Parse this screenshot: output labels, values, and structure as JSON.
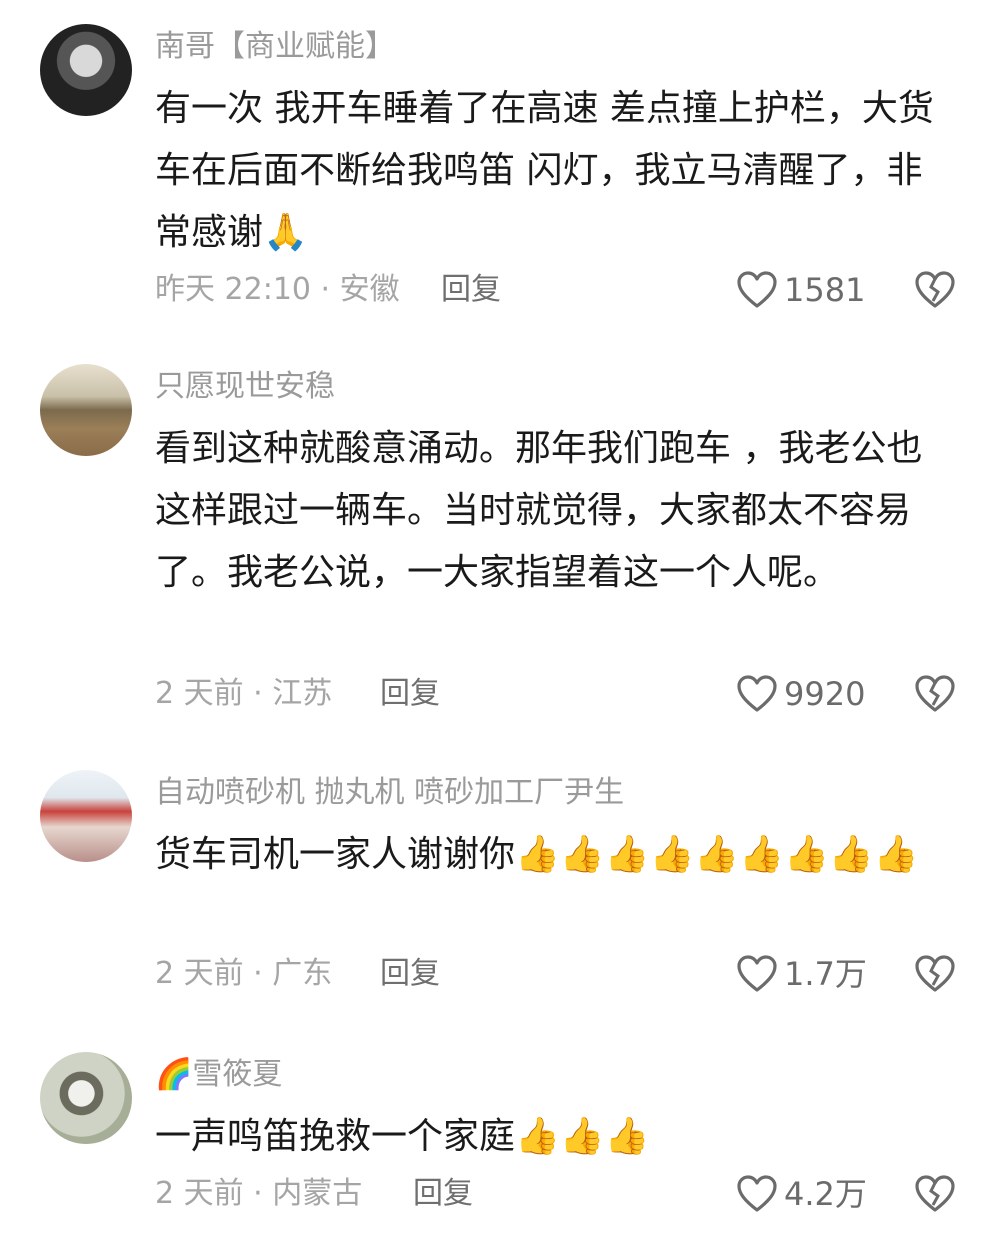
{
  "comments": [
    {
      "username": "南哥【商业赋能】",
      "avatar_icon": "avatar-man-portrait",
      "text": "有一次 我开车睡着了在高速 差点撞上护栏，大货车在后面不断给我鸣笛 闪灯，我立马清醒了，非常感谢",
      "emoji": "🙏",
      "meta": "昨天 22:10 · 安徽",
      "reply_label": "回复",
      "likes": "1581"
    },
    {
      "username": "只愿现世安稳",
      "avatar_icon": "avatar-landscape",
      "text": "看到这种就酸意涌动。那年我们跑车 ，我老公也这样跟过一辆车。当时就觉得，大家都太不容易了。我老公说，一大家指望着这一个人呢。",
      "emoji": "",
      "meta": "2 天前 · 江苏",
      "reply_label": "回复",
      "likes": "9920"
    },
    {
      "username": "自动喷砂机 抛丸机 喷砂加工厂尹生",
      "avatar_icon": "avatar-factory",
      "text": "货车司机一家人谢谢你",
      "emoji": "👍👍👍👍👍👍👍👍👍",
      "meta": "2 天前 · 广东",
      "reply_label": "回复",
      "likes": "1.7万"
    },
    {
      "username": "🌈雪筱夏",
      "avatar_icon": "avatar-woman-outdoor",
      "text": "一声鸣笛挽救一个家庭",
      "emoji": "👍👍👍",
      "meta": "2 天前 · 内蒙古",
      "reply_label": "回复",
      "likes": "4.2万"
    }
  ],
  "colors": {
    "username": "#9a9a9a",
    "text": "#1a1a1a",
    "meta": "#a5a5a5",
    "reply": "#6f6f6f",
    "icon": "#6b6b6b"
  }
}
